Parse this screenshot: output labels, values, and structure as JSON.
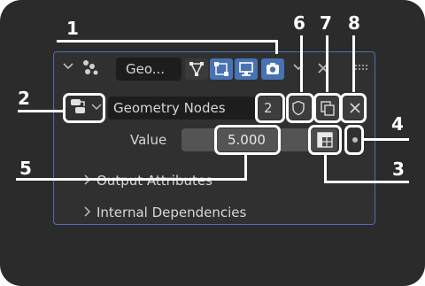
{
  "modifier": {
    "name": "Geo...",
    "type_label": "Geometry Nodes",
    "users_count": "2",
    "value_label": "Value",
    "value": "5.000"
  },
  "sections": [
    {
      "label": "Output Attributes"
    },
    {
      "label": "Internal Dependencies"
    }
  ],
  "header_icons": [
    "collapse-chevron-icon",
    "geometry-nodes-icon",
    "edit-mode-icon",
    "on-cage-icon",
    "viewport-icon",
    "render-icon",
    "dropdown-chevron-icon",
    "close-icon",
    "drag-handle-icon"
  ],
  "callouts": [
    "1",
    "2",
    "3",
    "4",
    "5",
    "6",
    "7",
    "8"
  ],
  "colors": {
    "accent_blue": "#4772b3",
    "panel_border": "#4d6fb2",
    "panel_bg": "#303030",
    "background": "#2b2b2b",
    "callout": "#ffffff"
  }
}
